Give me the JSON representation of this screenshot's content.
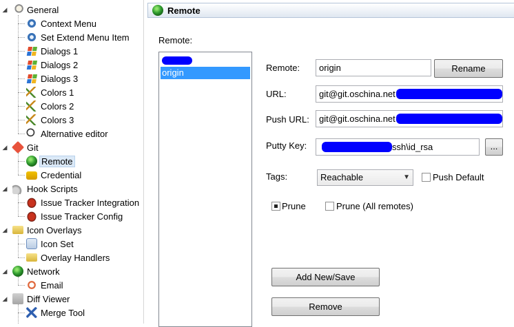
{
  "tree": {
    "items": [
      {
        "label": "General",
        "icon": "wrench-settings-icon",
        "level": 0,
        "expanded": true
      },
      {
        "label": "Context Menu",
        "icon": "gear-icon",
        "level": 1
      },
      {
        "label": "Set Extend Menu Item",
        "icon": "gear-icon",
        "level": 1
      },
      {
        "label": "Dialogs 1",
        "icon": "windows-logo-icon",
        "level": 1
      },
      {
        "label": "Dialogs 2",
        "icon": "windows-logo-icon",
        "level": 1
      },
      {
        "label": "Dialogs 3",
        "icon": "windows-logo-icon",
        "level": 1
      },
      {
        "label": "Colors 1",
        "icon": "color-brushes-icon",
        "level": 1
      },
      {
        "label": "Colors 2",
        "icon": "color-brushes-icon",
        "level": 1
      },
      {
        "label": "Colors 3",
        "icon": "color-brushes-icon",
        "level": 1
      },
      {
        "label": "Alternative editor",
        "icon": "magnifier-icon",
        "level": 1
      },
      {
        "label": "Git",
        "icon": "git-diamond-icon",
        "level": 0,
        "expanded": true
      },
      {
        "label": "Remote",
        "icon": "globe-icon",
        "level": 1,
        "selected": true
      },
      {
        "label": "Credential",
        "icon": "lock-icon",
        "level": 1
      },
      {
        "label": "Hook Scripts",
        "icon": "hook-icon",
        "level": 0,
        "expanded": true
      },
      {
        "label": "Issue Tracker Integration",
        "icon": "bug-icon",
        "level": 1
      },
      {
        "label": "Issue Tracker Config",
        "icon": "bug-icon",
        "level": 1
      },
      {
        "label": "Icon Overlays",
        "icon": "overlay-folder-icon",
        "level": 0,
        "expanded": true
      },
      {
        "label": "Icon Set",
        "icon": "icon-set-icon",
        "level": 1
      },
      {
        "label": "Overlay Handlers",
        "icon": "overlay-folder-icon",
        "level": 1
      },
      {
        "label": "Network",
        "icon": "globe-icon",
        "level": 0,
        "expanded": true
      },
      {
        "label": "Email",
        "icon": "email-at-icon",
        "level": 1
      },
      {
        "label": "Diff Viewer",
        "icon": "diff-viewer-icon",
        "level": 0,
        "expanded": true
      },
      {
        "label": "Merge Tool",
        "icon": "merge-arrows-icon",
        "level": 1
      }
    ]
  },
  "panel": {
    "title": "Remote",
    "remote_list_label": "Remote:",
    "remote_list": [
      {
        "label": "",
        "redacted": true
      },
      {
        "label": "origin",
        "selected": true
      }
    ],
    "remote_label": "Remote:",
    "remote_value": "origin",
    "rename_button": "Rename",
    "url_label": "URL:",
    "url_value": "git@git.oschina.net",
    "push_url_label": "Push URL:",
    "push_url_value": "git@git.oschina.net",
    "putty_key_label": "Putty Key:",
    "putty_key_value": "ssh\\id_rsa",
    "browse_button": "...",
    "tags_label": "Tags:",
    "tags_selected": "Reachable",
    "push_default_label": "Push Default",
    "push_default_checked": false,
    "prune_label": "Prune",
    "prune_checked": true,
    "prune_all_label": "Prune (All remotes)",
    "prune_all_checked": false,
    "add_new_save_button": "Add New/Save",
    "remove_button": "Remove"
  },
  "colors": {
    "selection": "#3399ff",
    "redaction": "#0000ff",
    "header_gradient_end": "#dfe7f1"
  }
}
